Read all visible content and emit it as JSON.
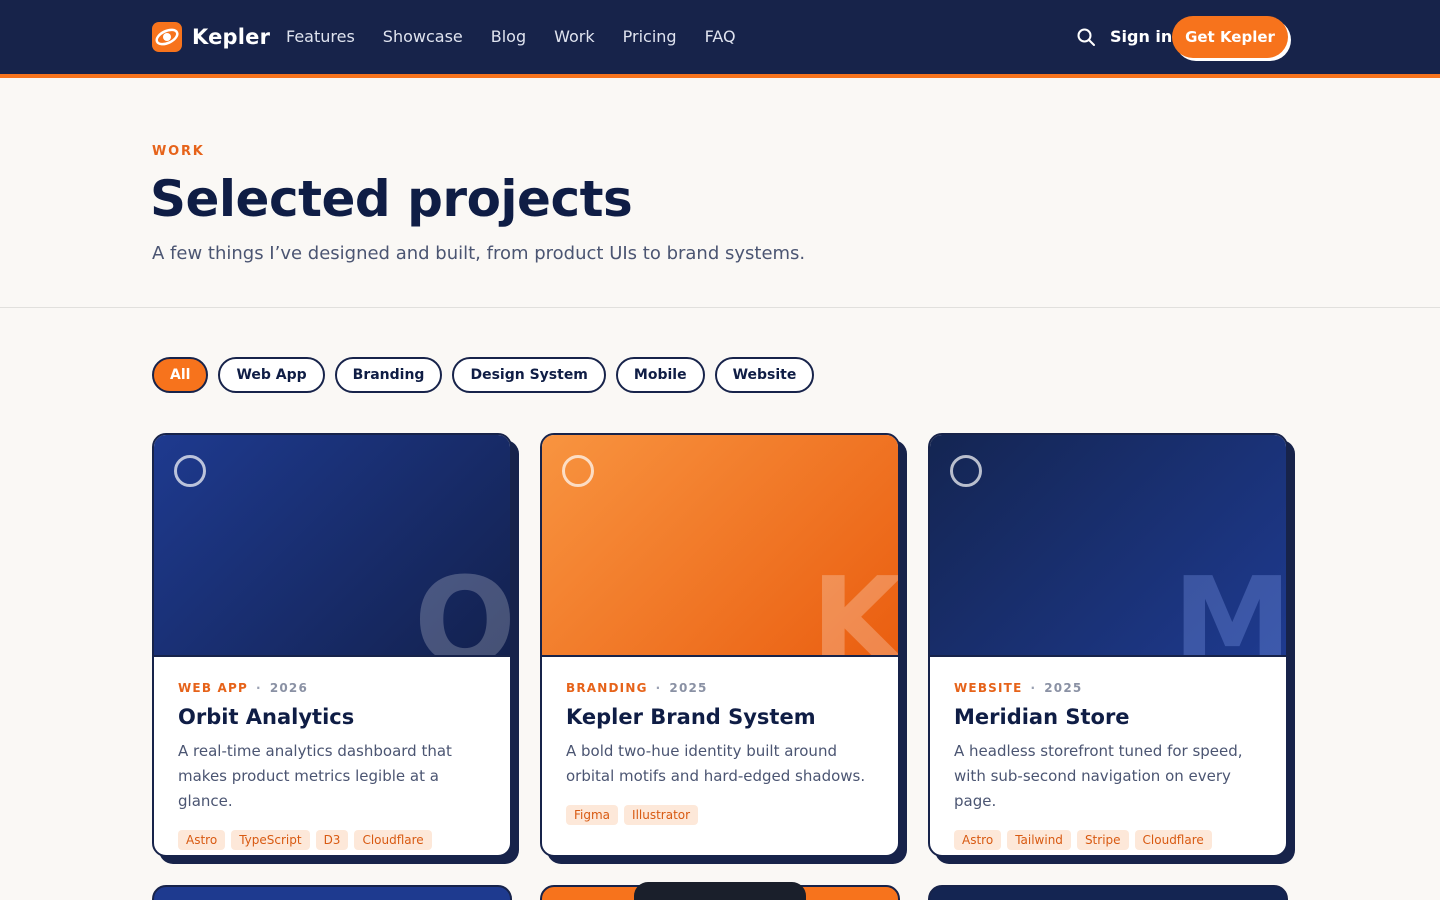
{
  "brand": {
    "name": "Kepler",
    "accent": "#f7731c",
    "navy": "#17234a"
  },
  "nav": {
    "items": [
      "Features",
      "Showcase",
      "Blog",
      "Work",
      "Pricing",
      "FAQ"
    ]
  },
  "header": {
    "search_icon": "search-icon",
    "signin": "Sign in",
    "cta": "Get Kepler"
  },
  "hero": {
    "eyebrow": "WORK",
    "title": "Selected projects",
    "subtitle": "A few things I’ve designed and built, from product UIs to brand systems."
  },
  "filters": {
    "items": [
      "All",
      "Web App",
      "Branding",
      "Design System",
      "Mobile",
      "Website"
    ],
    "active": "All"
  },
  "projects": [
    {
      "monogram": "O",
      "category": "WEB APP",
      "year": "2026",
      "title": "Orbit Analytics",
      "description": "A real-time analytics dashboard that makes product metrics legible at a glance.",
      "tags": [
        "Astro",
        "TypeScript",
        "D3",
        "Cloudflare"
      ]
    },
    {
      "monogram": "K",
      "category": "BRANDING",
      "year": "2025",
      "title": "Kepler Brand System",
      "description": "A bold two-hue identity built around orbital motifs and hard-edged shadows.",
      "tags": [
        "Figma",
        "Illustrator"
      ]
    },
    {
      "monogram": "M",
      "category": "WEBSITE",
      "year": "2025",
      "title": "Meridian Store",
      "description": "A headless storefront tuned for speed, with sub-second navigation on every page.",
      "tags": [
        "Astro",
        "Tailwind",
        "Stripe",
        "Cloudflare"
      ]
    }
  ]
}
